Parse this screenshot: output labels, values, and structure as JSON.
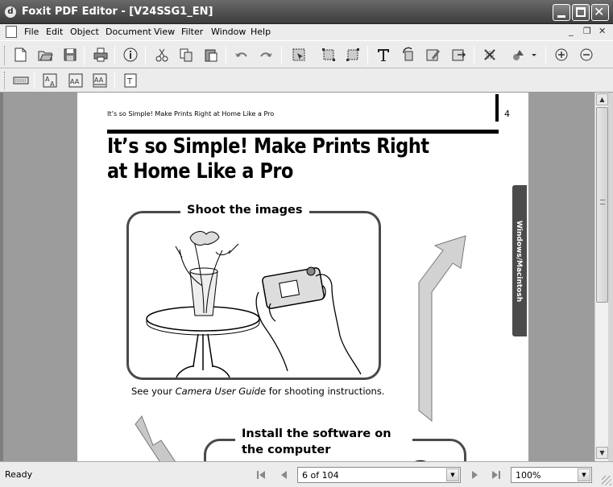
{
  "window": {
    "title": "Foxit PDF Editor - [V24SSG1_EN]",
    "app_icon": "foxit-logo-icon"
  },
  "menubar": {
    "items": [
      {
        "label": "File",
        "icon": "none"
      },
      {
        "label": "Edit",
        "icon": "none"
      },
      {
        "label": "Object",
        "icon": "none"
      },
      {
        "label": "Document",
        "icon": "none"
      },
      {
        "label": "View",
        "icon": "none"
      },
      {
        "label": "Filter",
        "icon": "none"
      },
      {
        "label": "Window",
        "icon": "none"
      },
      {
        "label": "Help",
        "icon": "none"
      }
    ],
    "mdi_controls": [
      "_",
      "❐",
      "✕"
    ]
  },
  "toolbar1": {
    "buttons": [
      "new-icon",
      "open-icon",
      "save-icon",
      "print-icon",
      "info-icon",
      "cut-icon",
      "copy-icon",
      "paste-icon",
      "undo-icon",
      "redo-icon",
      "select-object-icon",
      "move-icon",
      "resize-icon",
      "text-tool-icon",
      "rotate-icon",
      "edit-image-icon",
      "export-icon",
      "crop-icon",
      "shapes-icon",
      "zoom-in-icon",
      "zoom-out-icon"
    ]
  },
  "toolbar2": {
    "buttons": [
      "keyboard-icon",
      "font-icon",
      "align-icon",
      "spacing-icon",
      "text-box-icon"
    ]
  },
  "document": {
    "running_header": "It’s so Simple! Make Prints Right at Home Like a Pro",
    "page_number": "4",
    "title": "It’s so Simple! Make Prints Right at Home Like a Pro",
    "box1_label": "Shoot the images",
    "caption_prefix": "See your ",
    "caption_italic": "Camera User Guide",
    "caption_suffix": " for shooting instructions.",
    "box2_label": "Install the software on the computer",
    "side_tab": "Windows/Macintosh"
  },
  "statusbar": {
    "status": "Ready",
    "page_field": "6 of 104",
    "zoom_field": "100%"
  },
  "colors": {
    "titlebar": "#4a4a4a",
    "chrome": "#ececec",
    "workspace": "#9c9c9c"
  }
}
